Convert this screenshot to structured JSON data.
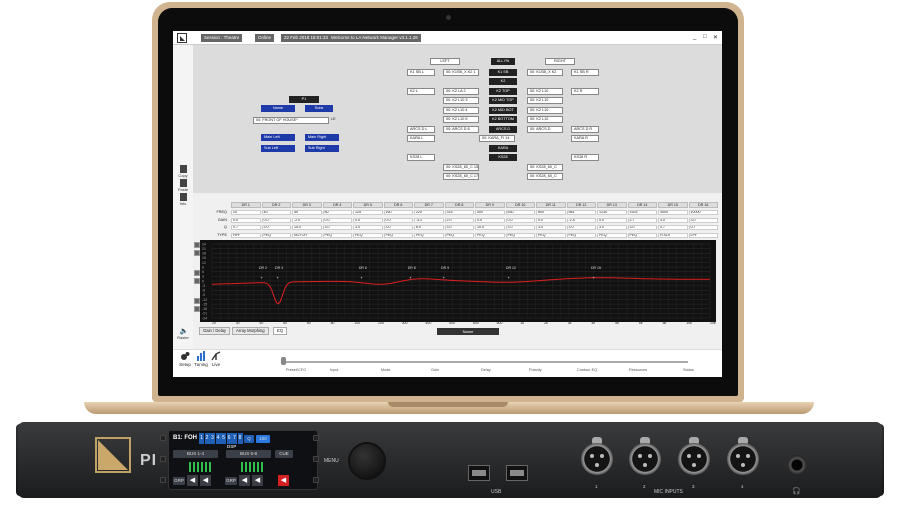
{
  "app": {
    "tabs": [
      "Session : Theatre",
      "Online",
      "22 Feb 2018 18:01:33",
      "Welcome to LA Network Manager v3.1.1.26"
    ],
    "window_controls": [
      "_",
      "□",
      "✕"
    ]
  },
  "tools": [
    "Copy",
    "Paste",
    "Info"
  ],
  "left_group": {
    "header": "P1",
    "col1": "Name",
    "col2": "Subs",
    "name_value": "00: FRONT OF HOUSE*",
    "subs_value": "LE",
    "buttons": [
      "Main Left",
      "Main Right",
      "Sub Left",
      "Sub Right"
    ]
  },
  "groups": {
    "top": [
      "LEFT",
      "ALL PA",
      "RIGHT"
    ],
    "left_labels": [
      "K1 SB L",
      "K2 L",
      "ARCS D L",
      "KARA L",
      "KS28 L"
    ],
    "right_labels": [
      "K1 SB R",
      "K2 R",
      "ARCS D R",
      "KARA R",
      "KS28 R"
    ],
    "center": [
      "K1 SB",
      "K2",
      "K2 TOP",
      "K2 MID TOP",
      "K2 MID BOT",
      "K2 BOTTOM",
      "ARCS D",
      "KARA",
      "KS28"
    ],
    "left_devices": [
      "00: K1SB_X K2   1",
      "00: K2 LA   2",
      "00: K2 L10   3",
      "00: K2 L10   4",
      "00: K2 L10   5",
      "00: K2 L10   6",
      "00: ARCS D   8",
      "00: K4 ARCS",
      "00: KS28_60_C   15",
      "00: KS28_60_C   17"
    ],
    "right_devices": [
      "00: K1SB_X K2",
      "00: K2 L10",
      "00: K2 L10",
      "00: K2 L10",
      "00: K2 L10",
      "00: K2 L10",
      "00: ARCS D",
      "00: KARA_FI   14",
      "00: KS28_60_C",
      "00: KS28_60_C"
    ]
  },
  "eq": {
    "headers": [
      "DR 1",
      "DR 2",
      "DR 3",
      "DR 4",
      "DR 5",
      "DR 6",
      "DR 7",
      "DR 8",
      "DR 9",
      "DR 10",
      "DR 11",
      "DR 12",
      "DR 13",
      "DR 14",
      "DR 15",
      "DR 16"
    ],
    "row_labels": [
      "FREQ",
      "GAIN",
      "Q",
      "TYPE"
    ],
    "freq": [
      "20",
      "40",
      "50",
      "80",
      "125",
      "160",
      "220",
      "315",
      "500",
      "630",
      "800",
      "981",
      "1230",
      "1525",
      "4000",
      "10000"
    ],
    "gain": [
      "0.0",
      "0.0",
      "-2.0",
      "0.0",
      "0.0",
      "0.0",
      "-4.2",
      "2.0",
      "0.0",
      "0.0",
      "0.0",
      "-2.5",
      "0.0",
      "2.7",
      "3.0",
      "3.0"
    ],
    "q": [
      "0.7",
      "3.0",
      "15.0",
      "3.0",
      "3.0",
      "3.0",
      "6.0",
      "3.0",
      "10.0",
      "3.0",
      "3.0",
      "3.0",
      "3.0",
      "3.0",
      "0.7",
      "0.7"
    ],
    "type": [
      "HPF",
      "PEQ",
      "NOTCH",
      "PEQ",
      "PEQ",
      "PEQ",
      "PEQ",
      "PEQ",
      "PEQ",
      "PEQ",
      "PEQ",
      "PEQ",
      "PEQ",
      "PEQ",
      "H.SLV",
      "LPF"
    ]
  },
  "plot": {
    "y_labels": [
      "24",
      "21",
      "18",
      "15",
      "12",
      "9",
      "6",
      "3",
      "0",
      "-3",
      "-6",
      "-9",
      "-12",
      "-15",
      "-18",
      "-21",
      "-24"
    ],
    "x_labels": [
      "20",
      "30",
      "40",
      "50",
      "60",
      "80",
      "100",
      "200",
      "300",
      "400",
      "500",
      "600",
      "800",
      "1k",
      "2k",
      "3k",
      "4k",
      "5k",
      "6k",
      "8k",
      "10k",
      "20k"
    ],
    "markers": [
      "DR 2",
      "DR 3",
      "DR 6",
      "DR 8",
      "DR 9",
      "DR 12",
      "DR 15"
    ],
    "curve_color": "#e02020"
  },
  "bottom_tabs": [
    "Gain / Delay",
    "Array Morphing",
    "EQ"
  ],
  "zoom_select": "Name",
  "nav": [
    "Setup",
    "Tuning",
    "Live"
  ],
  "side_item": "Raster",
  "steps": [
    "Preset/CFG",
    "Input",
    "Mode",
    "Gain",
    "Delay",
    "Polarity",
    "Contour EQ",
    "Resources",
    "Status"
  ],
  "rack": {
    "brand": "PI",
    "lcd": {
      "title": "B1: FOH",
      "channels": [
        "1",
        "2",
        "3",
        "4",
        "5",
        "6",
        "7",
        "8"
      ],
      "status": "Q",
      "level": "100",
      "dsp": "DSP",
      "bus1": "BUS 1-4",
      "bus2": "BUS 5-8",
      "cue": "CUE",
      "grp": "GRP"
    },
    "menu": "MENU",
    "usb": "USB",
    "mic_inputs": "MIC INPUTS",
    "xlr_numbers": [
      "1",
      "2",
      "3",
      "4"
    ],
    "headphones": "🎧"
  }
}
